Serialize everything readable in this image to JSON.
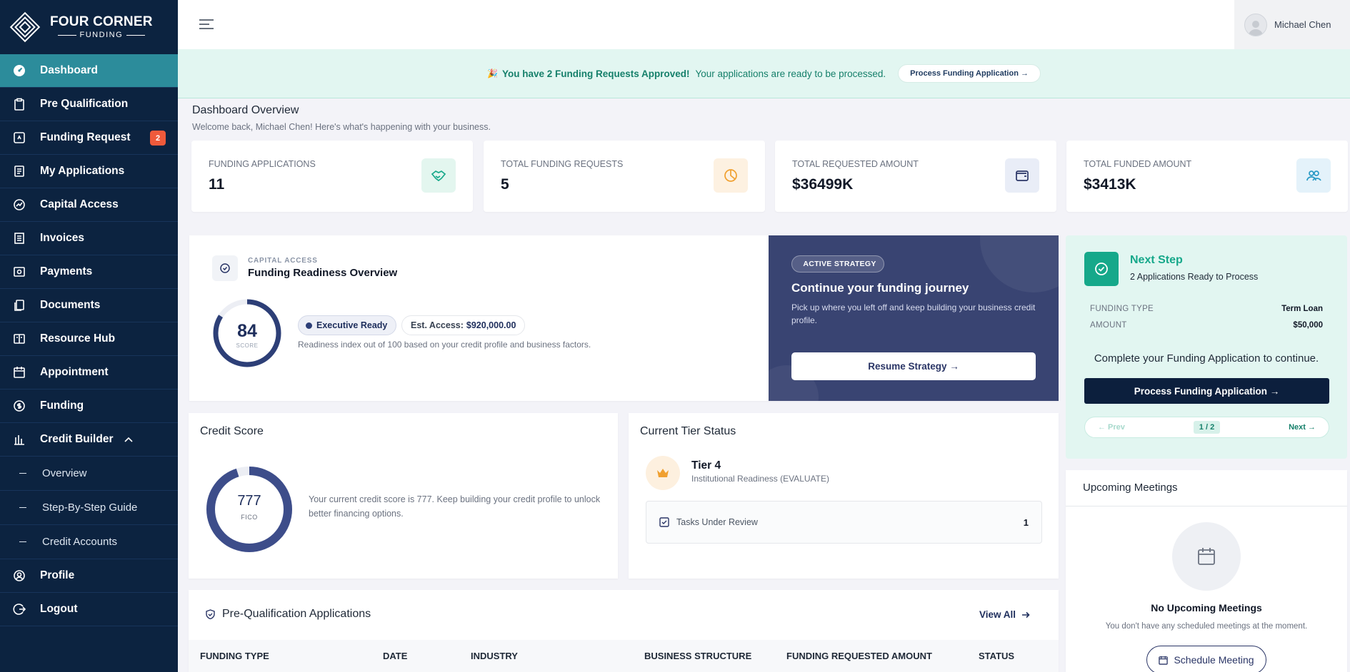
{
  "brand": {
    "line1": "FOUR CORNER",
    "line2": "FUNDING"
  },
  "sidebar": {
    "items": [
      {
        "label": "Dashboard",
        "icon": "dashboard-icon",
        "active": true
      },
      {
        "label": "Pre Qualification",
        "icon": "clipboard-icon"
      },
      {
        "label": "Funding Request",
        "icon": "dollar-doc-icon",
        "badge": "2"
      },
      {
        "label": "My Applications",
        "icon": "document-icon"
      },
      {
        "label": "Capital Access",
        "icon": "chart-circle-icon"
      },
      {
        "label": "Invoices",
        "icon": "invoice-icon"
      },
      {
        "label": "Payments",
        "icon": "payment-icon"
      },
      {
        "label": "Documents",
        "icon": "documents-icon"
      },
      {
        "label": "Resource Hub",
        "icon": "book-icon"
      },
      {
        "label": "Appointment",
        "icon": "calendar-icon"
      },
      {
        "label": "Funding",
        "icon": "coin-icon"
      },
      {
        "label": "Credit Builder",
        "icon": "building-icon",
        "expanded": true
      }
    ],
    "sub_items": [
      "Overview",
      "Step-By-Step Guide",
      "Credit Accounts"
    ],
    "bottom_items": [
      {
        "label": "Profile",
        "icon": "user-icon"
      },
      {
        "label": "Logout",
        "icon": "logout-icon"
      }
    ]
  },
  "header": {
    "user_name": "Michael Chen"
  },
  "banner": {
    "emoji": "🎉",
    "strong": "You have 2 Funding Requests Approved!",
    "text": "Your applications are ready to be processed.",
    "button": "Process Funding Application →"
  },
  "overview": {
    "title": "Dashboard Overview",
    "subtitle": "Welcome back, Michael Chen! Here's what's happening with your business."
  },
  "stats": [
    {
      "label": "FUNDING APPLICATIONS",
      "value": "11",
      "icon": "handshake-icon",
      "bg": "#e3f6ef",
      "color": "#16a88a"
    },
    {
      "label": "TOTAL FUNDING REQUESTS",
      "value": "5",
      "icon": "pie-chart-icon",
      "bg": "#fdf1e1",
      "color": "#f0a030"
    },
    {
      "label": "TOTAL REQUESTED AMOUNT",
      "value": "$36499K",
      "icon": "wallet-icon",
      "bg": "#e9edf7",
      "color": "#2a3566"
    },
    {
      "label": "TOTAL FUNDED AMOUNT",
      "value": "$3413K",
      "icon": "users-icon",
      "bg": "#e4f2fa",
      "color": "#2b9bc6"
    }
  ],
  "readiness": {
    "eyebrow": "CAPITAL ACCESS",
    "title": "Funding Readiness Overview",
    "score": "84",
    "score_label": "SCORE",
    "score_value": 84,
    "status_pill": "Executive Ready",
    "access_label": "Est. Access:",
    "access_value": "$920,000.00",
    "description": "Readiness index out of 100 based on your credit profile and business factors."
  },
  "strategy": {
    "tag": "ACTIVE STRATEGY",
    "title": "Continue your funding journey",
    "description": "Pick up where you left off and keep building your business credit profile.",
    "button": "Resume Strategy →"
  },
  "next_step": {
    "title": "Next Step",
    "subtitle": "2 Applications Ready to Process",
    "funding_type_label": "FUNDING TYPE",
    "funding_type": "Term Loan",
    "amount_label": "AMOUNT",
    "amount": "$50,000",
    "call": "Complete your Funding Application to continue.",
    "button": "Process Funding Application →",
    "prev": "← Prev",
    "page": "1 / 2",
    "next": "Next →"
  },
  "credit": {
    "title": "Credit Score",
    "score": "777",
    "label": "FICO",
    "fill_fraction": 0.95,
    "description": "Your current credit score is 777. Keep building your credit profile to unlock better financing options."
  },
  "tier": {
    "title": "Current Tier Status",
    "name": "Tier 4",
    "description": "Institutional Readiness (EVALUATE)",
    "task_label": "Tasks Under Review",
    "task_count": "1"
  },
  "meetings": {
    "title": "Upcoming Meetings",
    "empty_title": "No Upcoming Meetings",
    "empty_desc": "You don't have any scheduled meetings at the moment.",
    "button": "Schedule Meeting"
  },
  "prequal": {
    "title": "Pre-Qualification Applications",
    "view_all": "View All",
    "columns": [
      "FUNDING TYPE",
      "DATE",
      "INDUSTRY",
      "BUSINESS STRUCTURE",
      "FUNDING REQUESTED AMOUNT",
      "STATUS"
    ]
  }
}
